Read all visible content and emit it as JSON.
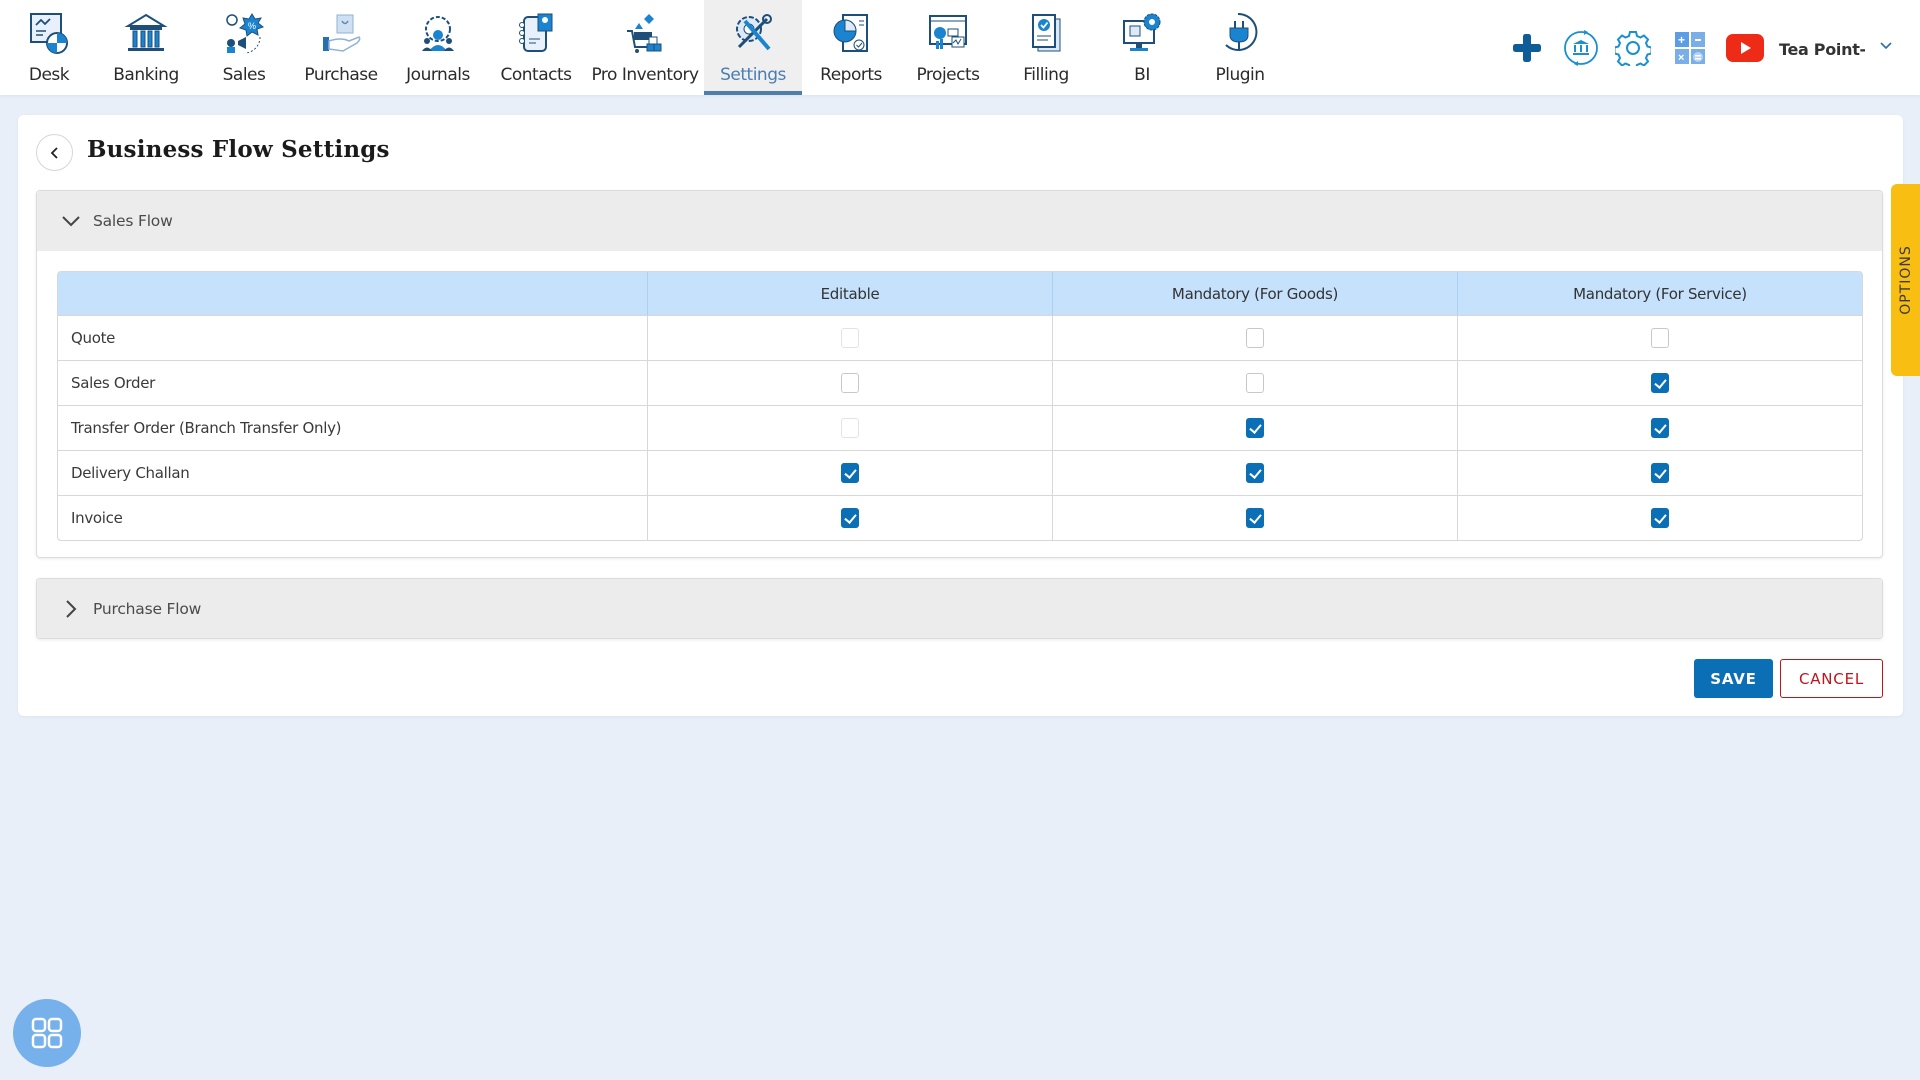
{
  "nav": {
    "items": [
      {
        "label": "Desk",
        "icon": "desk-icon",
        "active": false
      },
      {
        "label": "Banking",
        "icon": "bank-icon",
        "active": false
      },
      {
        "label": "Sales",
        "icon": "sales-icon",
        "active": false
      },
      {
        "label": "Purchase",
        "icon": "purchase-icon",
        "active": false
      },
      {
        "label": "Journals",
        "icon": "journals-icon",
        "active": false
      },
      {
        "label": "Contacts",
        "icon": "contacts-icon",
        "active": false
      },
      {
        "label": "Pro Inventory",
        "icon": "inventory-icon",
        "active": false
      },
      {
        "label": "Settings",
        "icon": "settings-tools-icon",
        "active": true
      },
      {
        "label": "Reports",
        "icon": "reports-icon",
        "active": false
      },
      {
        "label": "Projects",
        "icon": "projects-icon",
        "active": false
      },
      {
        "label": "Filling",
        "icon": "filling-icon",
        "active": false
      },
      {
        "label": "BI",
        "icon": "bi-icon",
        "active": false
      },
      {
        "label": "Plugin",
        "icon": "plugin-icon",
        "active": false
      }
    ],
    "tools": [
      "plus-icon",
      "bank-sync-icon",
      "gear-icon",
      "calculator-icon",
      "youtube-icon"
    ],
    "company": "Tea Point-A"
  },
  "page": {
    "title": "Business Flow Settings"
  },
  "sales_flow": {
    "title": "Sales Flow",
    "expanded": true,
    "columns": [
      "",
      "Editable",
      "Mandatory (For Goods)",
      "Mandatory (For Service)"
    ],
    "rows": [
      {
        "label": "Quote",
        "editable": {
          "checked": false,
          "disabled": true
        },
        "goods": {
          "checked": false,
          "disabled": false
        },
        "service": {
          "checked": false,
          "disabled": false
        }
      },
      {
        "label": "Sales Order",
        "editable": {
          "checked": false,
          "disabled": false
        },
        "goods": {
          "checked": false,
          "disabled": false
        },
        "service": {
          "checked": true,
          "disabled": false
        }
      },
      {
        "label": "Transfer Order (Branch Transfer Only)",
        "editable": {
          "checked": false,
          "disabled": true
        },
        "goods": {
          "checked": true,
          "disabled": false
        },
        "service": {
          "checked": true,
          "disabled": false
        }
      },
      {
        "label": "Delivery Challan",
        "editable": {
          "checked": true,
          "disabled": false
        },
        "goods": {
          "checked": true,
          "disabled": false
        },
        "service": {
          "checked": true,
          "disabled": false
        }
      },
      {
        "label": "Invoice",
        "editable": {
          "checked": true,
          "disabled": false
        },
        "goods": {
          "checked": true,
          "disabled": false
        },
        "service": {
          "checked": true,
          "disabled": false
        }
      }
    ]
  },
  "purchase_flow": {
    "title": "Purchase Flow",
    "expanded": false
  },
  "actions": {
    "save_label": "SAVE",
    "cancel_label": "CANCEL"
  },
  "options_tab": "OPTIONS",
  "colors": {
    "primary": "#0b6fb5",
    "danger": "#c0141b",
    "header_blue": "#c5e1fb",
    "options_yellow": "#f9be12",
    "youtube_red": "#ee2b17"
  }
}
